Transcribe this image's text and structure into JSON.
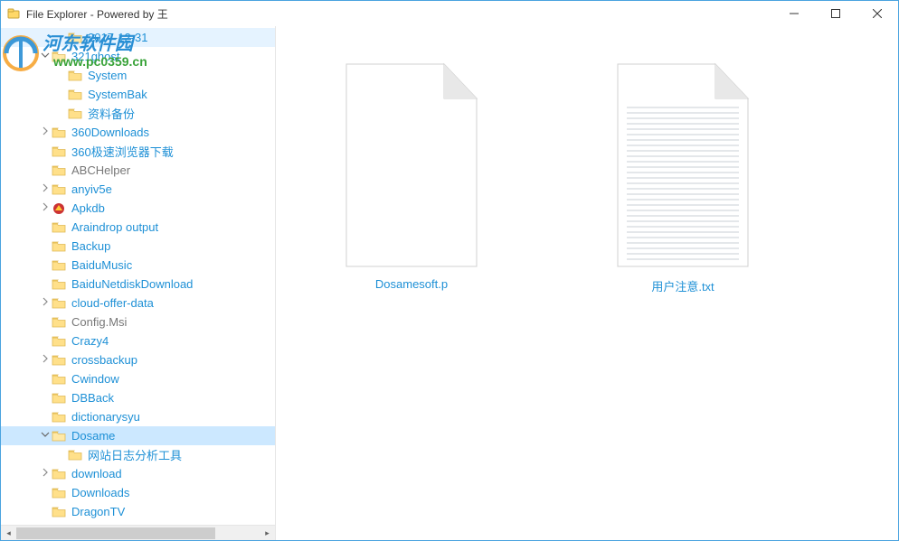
{
  "window": {
    "title": "File Explorer - Powered by 王",
    "min_btn": "minimize",
    "max_btn": "maximize",
    "close_btn": "close"
  },
  "watermark": {
    "text_top": "河东软件园",
    "text_url": "www.pc0359.cn"
  },
  "tree": [
    {
      "depth": 2,
      "expander": "none",
      "label": "2017-12-31",
      "state": "highlight"
    },
    {
      "depth": 1,
      "expander": "open",
      "label": "321ghost"
    },
    {
      "depth": 2,
      "expander": "none",
      "label": "System"
    },
    {
      "depth": 2,
      "expander": "none",
      "label": "SystemBak"
    },
    {
      "depth": 2,
      "expander": "none",
      "label": "资料备份"
    },
    {
      "depth": 1,
      "expander": "closed",
      "label": "360Downloads"
    },
    {
      "depth": 1,
      "expander": "none",
      "label": "360极速浏览器下载"
    },
    {
      "depth": 1,
      "expander": "none",
      "label": "ABCHelper",
      "dim": true
    },
    {
      "depth": 1,
      "expander": "closed",
      "label": "anyiv5e"
    },
    {
      "depth": 1,
      "expander": "closed",
      "label": "Apkdb",
      "icon": "apkdb"
    },
    {
      "depth": 1,
      "expander": "none",
      "label": "Araindrop output"
    },
    {
      "depth": 1,
      "expander": "none",
      "label": "Backup"
    },
    {
      "depth": 1,
      "expander": "none",
      "label": "BaiduMusic"
    },
    {
      "depth": 1,
      "expander": "none",
      "label": "BaiduNetdiskDownload"
    },
    {
      "depth": 1,
      "expander": "closed",
      "label": "cloud-offer-data"
    },
    {
      "depth": 1,
      "expander": "none",
      "label": "Config.Msi",
      "dim": true
    },
    {
      "depth": 1,
      "expander": "none",
      "label": "Crazy4"
    },
    {
      "depth": 1,
      "expander": "closed",
      "label": "crossbackup"
    },
    {
      "depth": 1,
      "expander": "none",
      "label": "Cwindow"
    },
    {
      "depth": 1,
      "expander": "none",
      "label": "DBBack"
    },
    {
      "depth": 1,
      "expander": "none",
      "label": "dictionarysyu"
    },
    {
      "depth": 1,
      "expander": "open",
      "label": "Dosame",
      "state": "selected"
    },
    {
      "depth": 2,
      "expander": "none",
      "label": "网站日志分析工具"
    },
    {
      "depth": 1,
      "expander": "closed",
      "label": "download"
    },
    {
      "depth": 1,
      "expander": "none",
      "label": "Downloads"
    },
    {
      "depth": 1,
      "expander": "none",
      "label": "DragonTV"
    }
  ],
  "files": [
    {
      "name": "Dosamesoft.p",
      "kind": "blank"
    },
    {
      "name": "用户注意.txt",
      "kind": "text"
    }
  ]
}
